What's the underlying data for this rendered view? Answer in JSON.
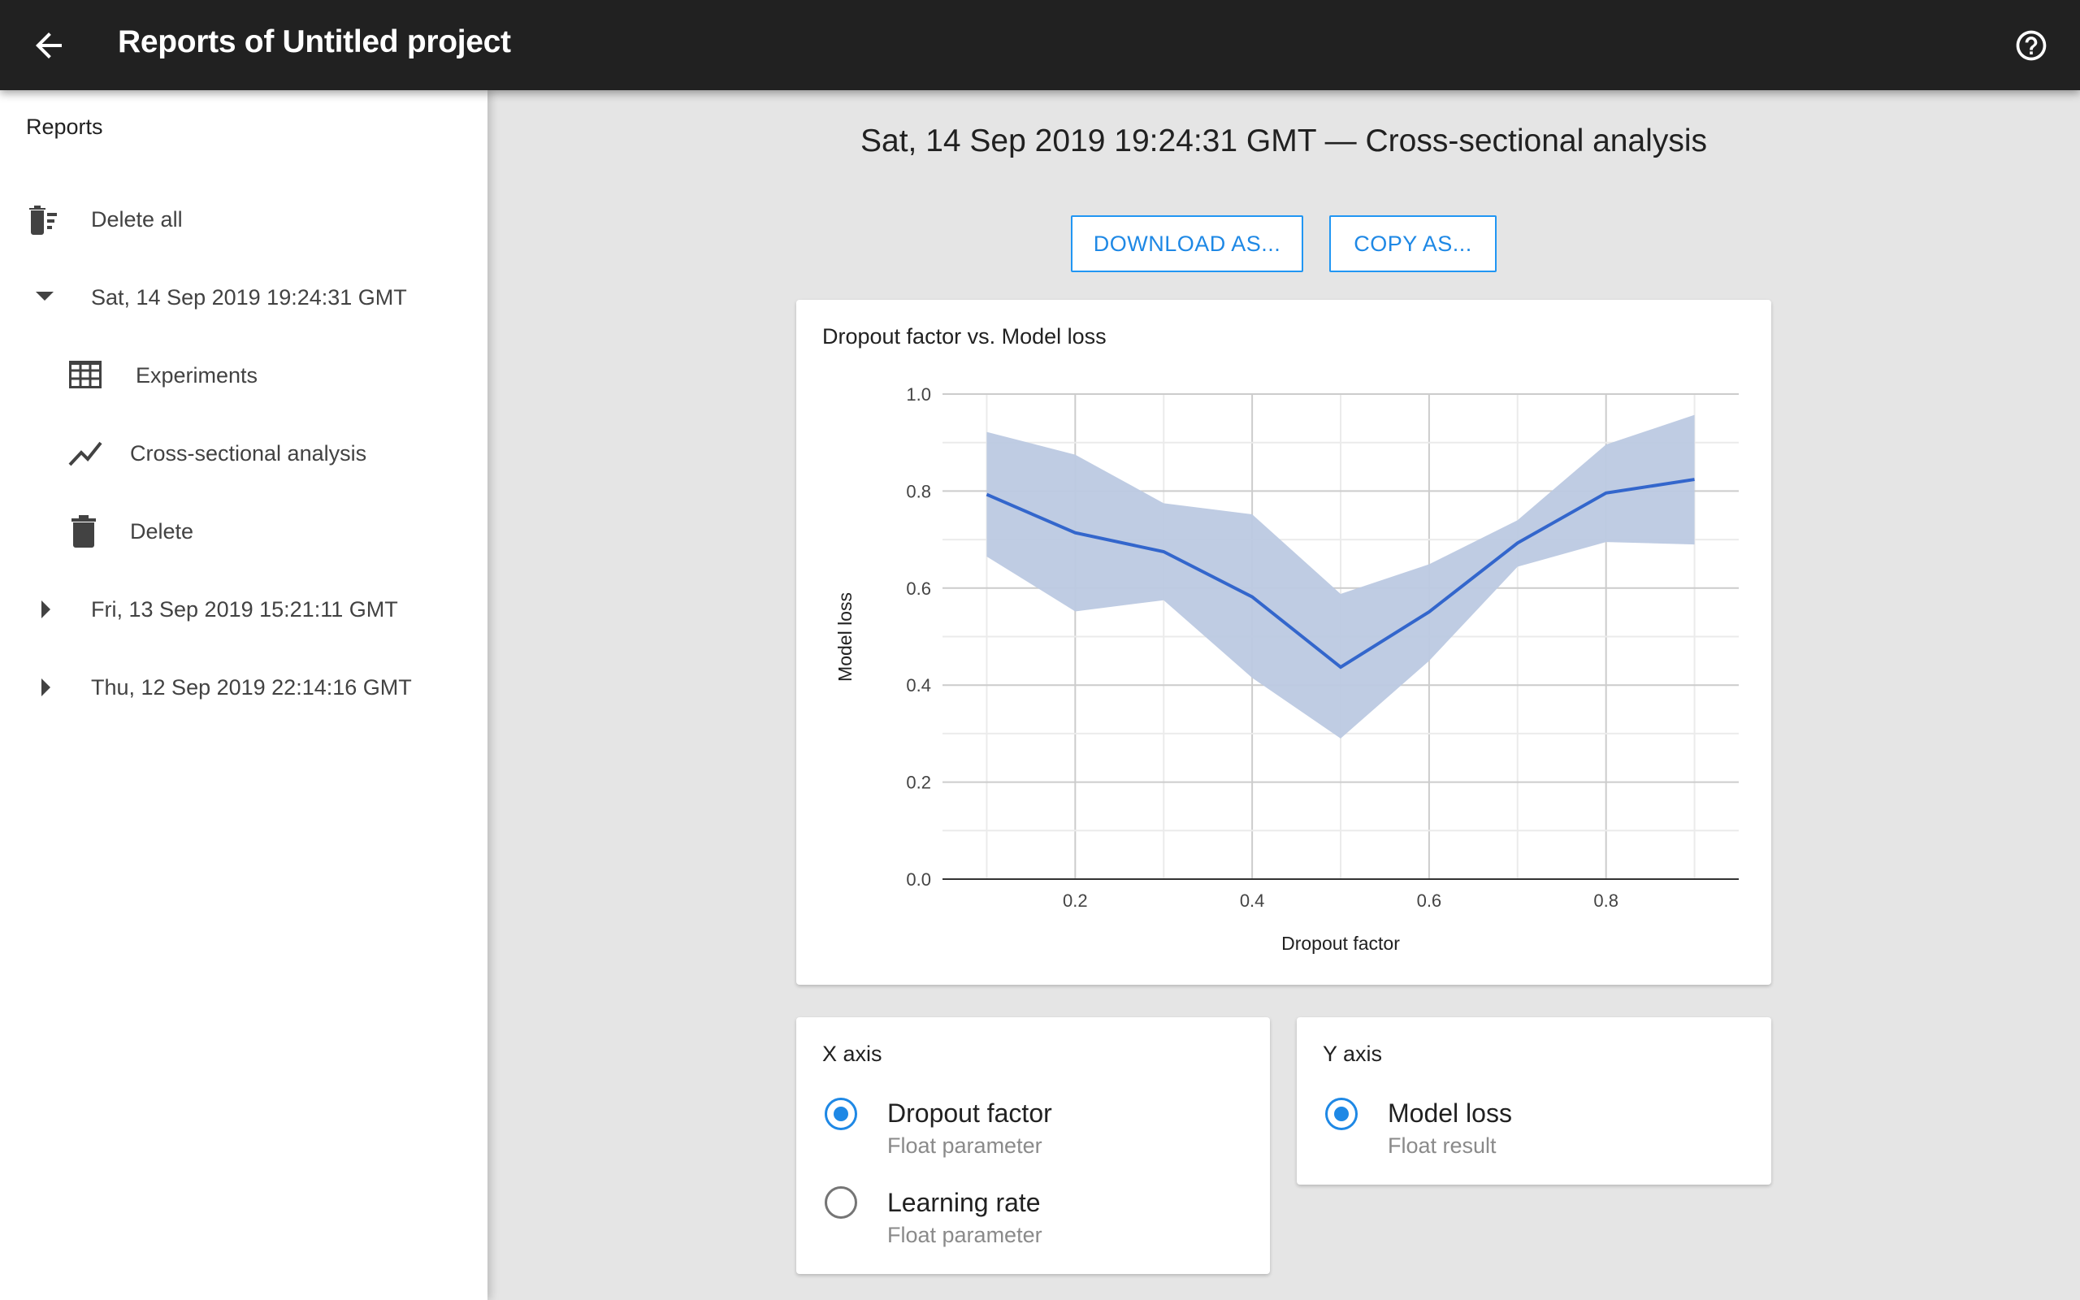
{
  "header": {
    "title": "Reports of Untitled project",
    "back_icon": "arrow-left-icon",
    "help_icon": "help-circle-icon"
  },
  "sidebar": {
    "heading": "Reports",
    "delete_all": "Delete all",
    "reports": [
      {
        "label": "Sat, 14 Sep 2019 19:24:31 GMT",
        "expanded": true,
        "children": [
          {
            "label": "Experiments",
            "icon": "table-icon"
          },
          {
            "label": "Cross-sectional analysis",
            "icon": "chart-line-icon"
          },
          {
            "label": "Delete",
            "icon": "trash-icon"
          }
        ]
      },
      {
        "label": "Fri, 13 Sep 2019 15:21:11 GMT",
        "expanded": false
      },
      {
        "label": "Thu, 12 Sep 2019 22:14:16 GMT",
        "expanded": false
      }
    ]
  },
  "main": {
    "title": "Sat, 14 Sep 2019 19:24:31 GMT — Cross-sectional analysis",
    "download_label": "DOWNLOAD AS...",
    "copy_label": "COPY AS...",
    "x_axis": {
      "title": "X axis",
      "options": [
        {
          "label": "Dropout factor",
          "sub": "Float parameter",
          "selected": true
        },
        {
          "label": "Learning rate",
          "sub": "Float parameter",
          "selected": false
        }
      ]
    },
    "y_axis": {
      "title": "Y axis",
      "options": [
        {
          "label": "Model loss",
          "sub": "Float result",
          "selected": true
        }
      ]
    }
  },
  "colors": {
    "accent": "#1e88e5",
    "line": "#3366cc",
    "band": "#bcc9e2",
    "header": "#212121"
  },
  "chart_data": {
    "type": "line",
    "title": "Dropout factor vs. Model loss",
    "xlabel": "Dropout factor",
    "ylabel": "Model loss",
    "xlim": [
      0.05,
      0.95
    ],
    "ylim": [
      0,
      1
    ],
    "xticks": [
      "0.2",
      "0.4",
      "0.6",
      "0.8"
    ],
    "yticks": [
      "0.0",
      "0.2",
      "0.4",
      "0.6",
      "0.8",
      "1.0"
    ],
    "grid": true,
    "x": [
      0.1,
      0.2,
      0.3,
      0.4,
      0.5,
      0.6,
      0.7,
      0.8,
      0.9
    ],
    "series": [
      {
        "values": [
          0.793,
          0.714,
          0.675,
          0.582,
          0.437,
          0.551,
          0.693,
          0.796,
          0.824
        ],
        "upper": [
          0.922,
          0.875,
          0.775,
          0.752,
          0.588,
          0.649,
          0.74,
          0.896,
          0.957
        ],
        "lower": [
          0.665,
          0.552,
          0.575,
          0.415,
          0.29,
          0.45,
          0.644,
          0.695,
          0.69
        ]
      }
    ]
  }
}
